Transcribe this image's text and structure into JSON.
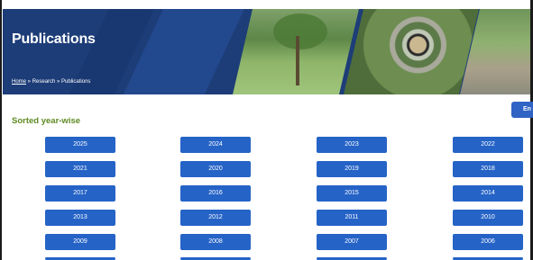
{
  "banner": {
    "title": "Publications",
    "breadcrumb": {
      "home": "Home",
      "sep1": " » ",
      "research": "Research",
      "sep2": " » ",
      "current": "Publications"
    }
  },
  "language_button": {
    "label": "En"
  },
  "section": {
    "title": "Sorted year-wise"
  },
  "years": [
    [
      "2025",
      "2024",
      "2023",
      "2022"
    ],
    [
      "2021",
      "2020",
      "2019",
      "2018"
    ],
    [
      "2017",
      "2016",
      "2015",
      "2014"
    ],
    [
      "2013",
      "2012",
      "2011",
      "2010"
    ],
    [
      "2009",
      "2008",
      "2007",
      "2006"
    ]
  ],
  "colors": {
    "banner": "#1d3d78",
    "button": "#2563c7",
    "section_title": "#5e8a21"
  }
}
